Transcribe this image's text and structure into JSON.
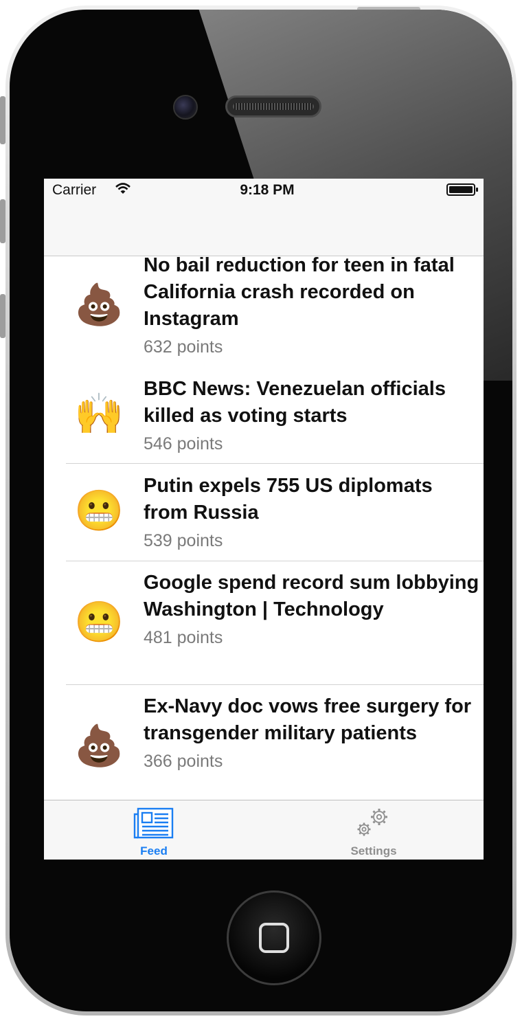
{
  "status_bar": {
    "carrier": "Carrier",
    "time": "9:18 PM"
  },
  "feed": {
    "items": [
      {
        "emoji": "💩",
        "title": "No bail reduction for teen in fatal California crash recorded on Instagram",
        "points": "632 points"
      },
      {
        "emoji": "🙌",
        "title": "BBC News: Venezuelan officials killed as voting starts",
        "points": "546 points"
      },
      {
        "emoji": "😬",
        "title": "Putin expels 755 US diplomats from Russia",
        "points": "539 points"
      },
      {
        "emoji": "😬",
        "title": "Google spend record sum lobbying Washington | Technology",
        "points": "481 points"
      },
      {
        "emoji": "💩",
        "title": "Ex-Navy doc vows free surgery for transgender military patients",
        "points": "366 points"
      }
    ]
  },
  "tab_bar": {
    "feed_label": "Feed",
    "settings_label": "Settings",
    "feed_icon": "newspaper-icon",
    "settings_icon": "gears-icon",
    "active_color": "#1a7ef2",
    "inactive_color": "#8e8e8e"
  }
}
